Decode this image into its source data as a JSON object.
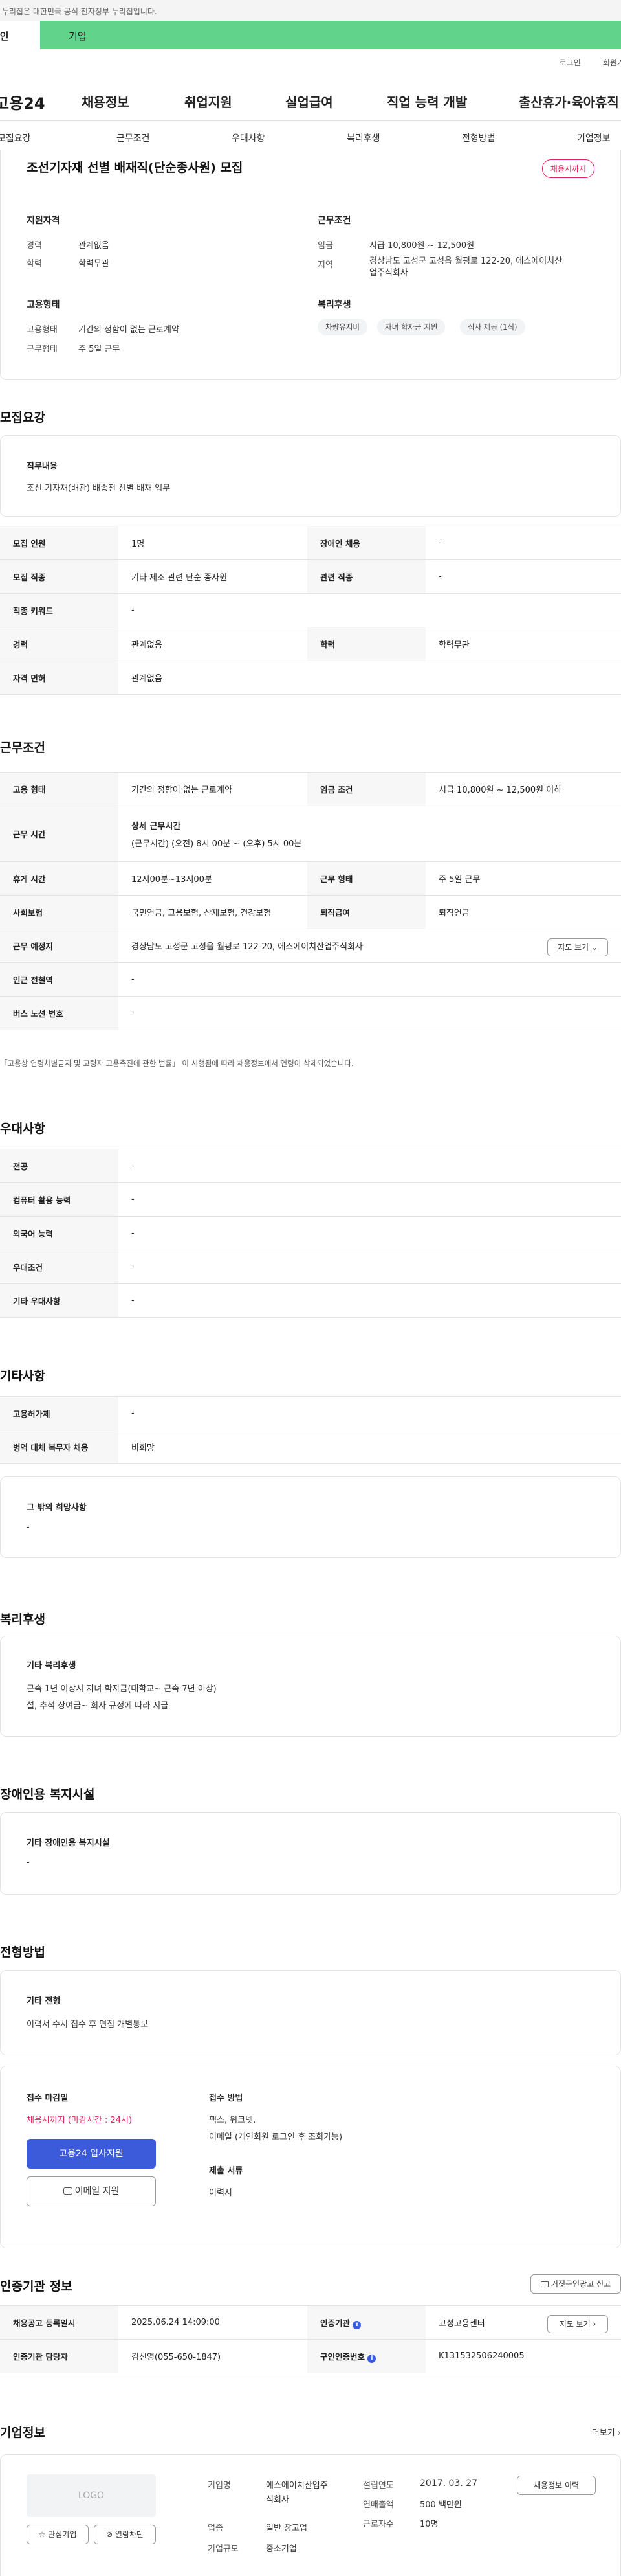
{
  "gov_banner": "이 누리집은 대한민국 공식 전자정부 누리집입니다.",
  "tabs": {
    "individual": "개인",
    "corporate": "기업"
  },
  "util": {
    "login": "로그인",
    "join": "회원가입"
  },
  "logo": "고용24",
  "gnb": [
    "채용정보",
    "취업지원",
    "실업급여",
    "직업 능력 개발",
    "출산휴가·육아휴직"
  ],
  "subnav": [
    "모집요강",
    "근무조건",
    "우대사항",
    "복리후생",
    "전형방법",
    "기업정보"
  ],
  "header": {
    "title": "조선기자재 선별 배재직(단순종사원) 모집",
    "deadline_badge": "채용시까지",
    "qual_title": "지원자격",
    "qual": [
      {
        "l": "경력",
        "v": "관계없음"
      },
      {
        "l": "학력",
        "v": "학력무관"
      }
    ],
    "cond_title": "근무조건",
    "cond": [
      {
        "l": "임금",
        "v": "시급 10,800원 ~ 12,500원"
      },
      {
        "l": "지역",
        "v1": "경상남도 고성군 고성읍 월평로 122-20, 에스에이치산",
        "v2": "업주식회사"
      }
    ],
    "emp_title": "고용형태",
    "emp": [
      {
        "l": "고용형태",
        "v": "기간의 정함이 없는 근로계약"
      },
      {
        "l": "근무형태",
        "v": "주 5일 근무"
      }
    ],
    "welfare_title": "복리후생",
    "welfare_chips": [
      "차량유지비",
      "자녀 학자금 지원",
      "식사 제공 (1식)"
    ]
  },
  "recruit": {
    "title": "모집요강",
    "job_title": "직무내용",
    "job_desc": "조선 기자재(배관) 배송전 선별 배재 업무",
    "rows": [
      {
        "a": "모집 인원",
        "b": "1명",
        "c": "장애인 채용",
        "d": "-"
      },
      {
        "a": "모집 직종",
        "b": "기타 제조 관련 단순 종사원",
        "c": "관련 직종",
        "d": "-"
      },
      {
        "a": "직종 키워드",
        "b": "-"
      },
      {
        "a": "경력",
        "b": "관계없음",
        "c": "학력",
        "d": "학력무관"
      },
      {
        "a": "자격 면허",
        "b": "관계없음"
      }
    ]
  },
  "work": {
    "title": "근무조건",
    "row1": {
      "a": "고용 형태",
      "b": "기간의 정함이 없는 근로계약",
      "c": "임금 조건",
      "d": "시급 10,800원 ~ 12,500원 이하"
    },
    "hours_label": "근무 시간",
    "hours_head": "상세 근무시간",
    "hours_val": "(근무시간) (오전) 8시 00분 ~ (오후) 5시 00분",
    "row3": {
      "a": "휴게 시간",
      "b": "12시00분~13시00분",
      "c": "근무 형태",
      "d": "주 5일 근무"
    },
    "row4": {
      "a": "사회보험",
      "b": "국민연금, 고용보험, 산재보험, 건강보험",
      "c": "퇴직급여",
      "d": "퇴직연금"
    },
    "row5": {
      "a": "근무 예정지",
      "b": "경상남도 고성군 고성읍 월평로 122-20, 에스에이치산업주식회사",
      "btn": "지도 보기 ⌄"
    },
    "row6": {
      "a": "인근 전철역",
      "b": "-"
    },
    "row7": {
      "a": "버스 노선 번호",
      "b": "-"
    },
    "note": "「고용상 연령차별금지 및 고령자 고용촉진에 관한 법률」 이 시행됨에 따라 채용정보에서 연령이 삭제되었습니다."
  },
  "pref": {
    "title": "우대사항",
    "rows": [
      {
        "a": "전공",
        "b": "-"
      },
      {
        "a": "컴퓨터 활용 능력",
        "b": "-"
      },
      {
        "a": "외국어 능력",
        "b": "-"
      },
      {
        "a": "우대조건",
        "b": "-"
      },
      {
        "a": "기타 우대사항",
        "b": "-"
      }
    ]
  },
  "etc": {
    "title": "기타사항",
    "rows": [
      {
        "a": "고용허가제",
        "b": "-"
      },
      {
        "a": "병역 대체 복무자 채용",
        "b": "비희망"
      }
    ],
    "other_title": "그 밖의 희망사항",
    "other_val": "-"
  },
  "benefit": {
    "title": "복리후생",
    "box_title": "기타 복리후생",
    "line1": "근속 1년 이상시 자녀 학자금(대학교~ 근속 7년 이상)",
    "line2": "설, 추석 상여금~ 회사 규정에 따라 지급"
  },
  "disab": {
    "title": "장애인용 복지시설",
    "box_title": "기타 장애인용 복지시설",
    "val": "-"
  },
  "screen": {
    "title": "전형방법",
    "box_title": "기타 전형",
    "val": "이력서 수시 접수 후 면접 개별통보"
  },
  "apply": {
    "deadline_title": "접수 마감일",
    "deadline_val": "채용시까지 (마감시간 : 24시)",
    "btn_apply": "고용24 입사지원",
    "btn_email": "이메일 지원",
    "method_title": "접수 방법",
    "method_1": "팩스, 워크넷,",
    "method_2": "이메일 (개인회원 로그인 후 조회가능)",
    "docs_title": "제출 서류",
    "docs_val": "이력서"
  },
  "agency": {
    "title": "인증기관 정보",
    "report_btn": "거짓구인광고 신고",
    "rows": [
      {
        "a": "채용공고 등록일시",
        "b": "2025.06.24 14:09:00",
        "c": "인증기관",
        "d": "고성고용센터",
        "btn": "지도 보기 ›"
      },
      {
        "a": "인증기관 담당자",
        "b": "김선영(055-650-1847)",
        "c": "구인인증번호",
        "d": "K131532506240005"
      }
    ]
  },
  "company": {
    "title": "기업정보",
    "more": "더보기 ›",
    "logo": "LOGO",
    "fav": "관심기업",
    "block": "열람차단",
    "name_l": "기업명",
    "name_v1": "에스에이치산업주",
    "name_v2": "식회사",
    "ind_l": "업종",
    "ind_v": "일반 창고업",
    "size_l": "기업규모",
    "size_v": "중소기업",
    "year_l": "설립연도",
    "year_v": "2017. 03. 27",
    "sales_l": "연매출액",
    "sales_v": "500 백만원",
    "emp_l": "근로자수",
    "emp_v": "10명",
    "history_btn": "채용정보 이력"
  }
}
